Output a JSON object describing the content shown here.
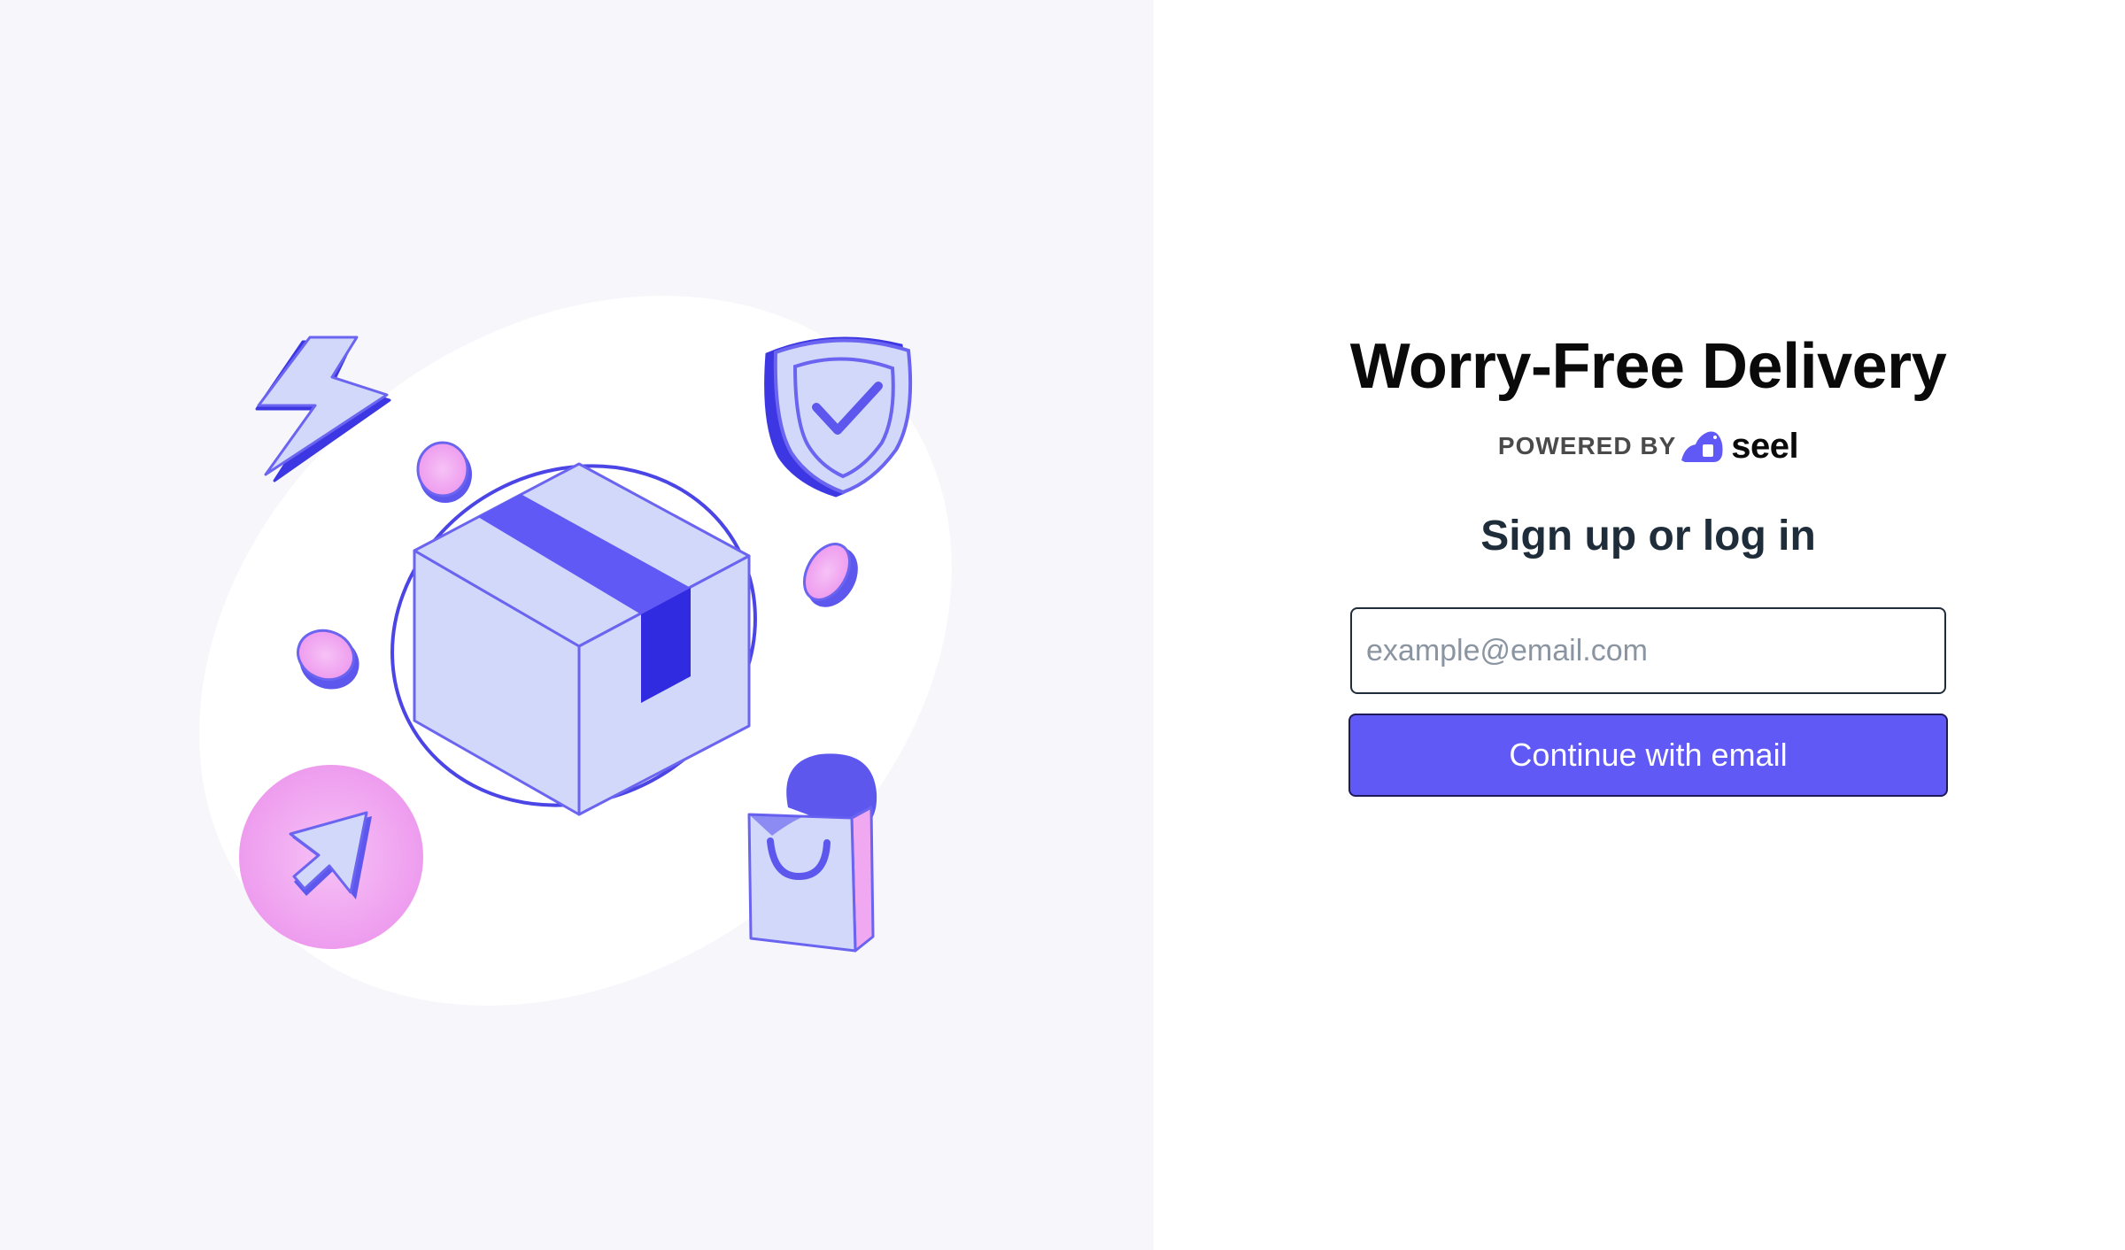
{
  "colors": {
    "accent": "#6159f5",
    "left_background": "#f7f7fb",
    "illustration_light": "#d1d8fa",
    "illustration_stroke": "#6a64f0",
    "illustration_dark": "#302be0",
    "illustration_pink": "#f0a8f0"
  },
  "illustration": {
    "icons": [
      "lightning-icon",
      "shield-check-icon",
      "package-box-icon",
      "shopping-bag-icon",
      "cursor-icon",
      "coin-icon"
    ]
  },
  "auth": {
    "title": "Worry-Free Delivery",
    "powered_by": "POWERED BY",
    "brand_name": "seel",
    "brand_icon": "seel-logo-icon",
    "subtitle": "Sign up or log in",
    "email_placeholder": "example@email.com",
    "email_value": "",
    "continue_label": "Continue with email"
  }
}
